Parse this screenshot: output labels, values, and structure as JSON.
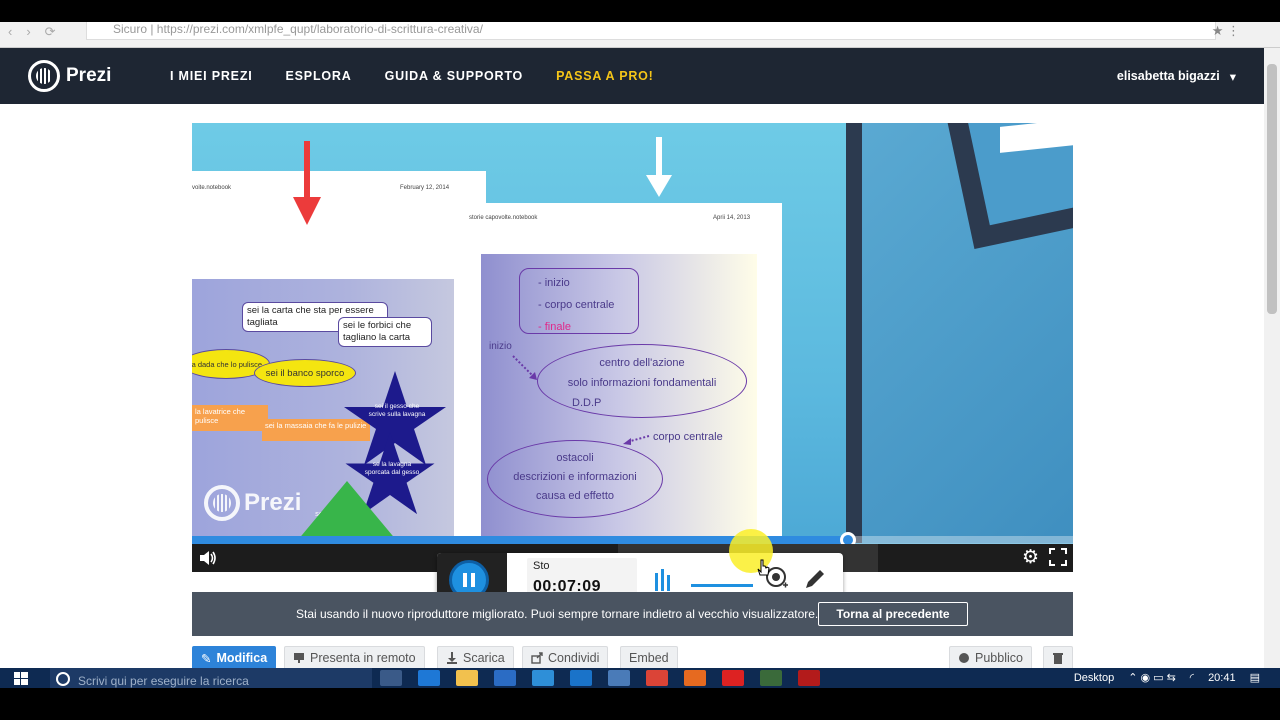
{
  "browser": {
    "url": "Sicuro | https://prezi.com/xmlpfe_qupt/laboratorio-di-scrittura-creativa/"
  },
  "header": {
    "logo": "Prezi",
    "nav": [
      "I MIEI PREZI",
      "ESPLORA",
      "GUIDA & SUPPORTO",
      "PASSA A PRO!"
    ],
    "user": "elisabetta bigazzi"
  },
  "slide": {
    "sheet1_title": "voite.notebook",
    "sheet1_date": "February 12, 2014",
    "sheet2_title": "storie capovolte.notebook",
    "sheet2_date": "Aprii 14, 2013",
    "left_bubbles": [
      "sei la carta che sta per essere tagliata",
      "sei le forbici che tagliano la carta",
      "la dada che lo pulisce",
      "sei il banco sporco",
      "la lavatrice che pulisce",
      "sei la massaia che fa le pulizie",
      "sei il gesso che scrive sulla lavagna",
      "se la lavagna sporcata dal gesso",
      "sei il bimbo che insegue"
    ],
    "right_box": [
      "- inizio",
      "- corpo centrale",
      "- finale"
    ],
    "right_label_inizio": "inizio",
    "right_ellipse1": [
      "centro dell'azione",
      "solo informazioni fondamentali",
      "D.D.P"
    ],
    "right_label_corpo": "corpo centrale",
    "right_ellipse2": [
      "ostacoli",
      "descrizioni e informazioni",
      "causa ed effetto"
    ],
    "watermark": "Prezi"
  },
  "player": {
    "progress": 0.745
  },
  "recorder": {
    "label": "Sto",
    "time": "00:07:09"
  },
  "notice": {
    "text": "Stai usando il nuovo riproduttore migliorato. Puoi sempre tornare indietro al vecchio visualizzatore.",
    "button": "Torna al precedente"
  },
  "actions": {
    "edit": "Modifica",
    "present": "Presenta in remoto",
    "download": "Scarica",
    "share": "Condividi",
    "embed": "Embed",
    "public": "Pubblico"
  },
  "taskbar": {
    "search_placeholder": "Scrivi qui per eseguire la ricerca",
    "desktop": "Desktop",
    "clock": "20:41"
  },
  "colors": {
    "header": "#1e2633",
    "accent": "#2d83d9",
    "pro": "#f5c518"
  }
}
